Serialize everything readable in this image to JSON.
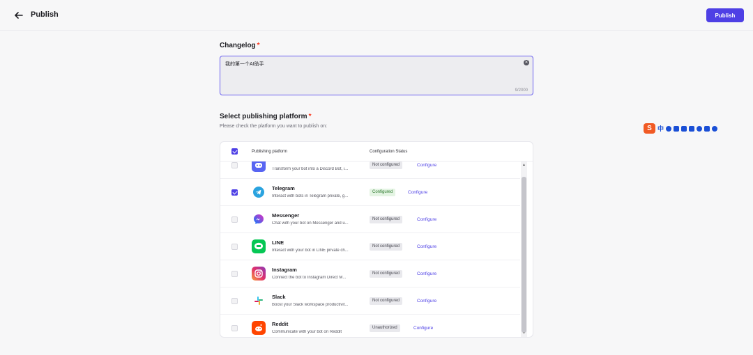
{
  "header": {
    "title": "Publish",
    "publish_label": "Publish",
    "back_icon": "arrow-left-icon"
  },
  "changelog": {
    "label": "Changelog",
    "required_mark": "*",
    "value": "我的第一个AI助手",
    "counter": "9/2000",
    "clear_icon": "clear-circle-icon"
  },
  "platform": {
    "label": "Select publishing platform",
    "required_mark": "*",
    "hint": "Please check the platform you want to publish on:"
  },
  "ime_toolbar": {
    "logo": "S",
    "lang": "中",
    "icons": [
      "punctuation-icon",
      "mic-icon",
      "keyboard-icon",
      "skin-icon",
      "robot-icon",
      "grid-icon",
      "settings-icon"
    ]
  },
  "table": {
    "col_platform": "Publishing platform",
    "col_status": "Configuration Status",
    "header_checked": true,
    "rows": [
      {
        "name": "",
        "desc": "Transform your bot into a Discord Bot, i...",
        "status": "Not configured",
        "configure": "Configure",
        "checked": false,
        "icon": "discord-icon",
        "icon_color": "#5865f2",
        "status_type": "neutral"
      },
      {
        "name": "Telegram",
        "desc": "Interact with bots in Telegram private, g...",
        "status": "Configured",
        "configure": "Configure",
        "checked": true,
        "icon": "telegram-icon",
        "icon_color": "#2aa3df",
        "status_type": "ok"
      },
      {
        "name": "Messenger",
        "desc": "Chat with your bot on Messenger and u...",
        "status": "Not configured",
        "configure": "Configure",
        "checked": false,
        "icon": "messenger-icon",
        "icon_color": "#8a3df0",
        "status_type": "neutral"
      },
      {
        "name": "LINE",
        "desc": "Interact with your bot in LINE private ch...",
        "status": "Not configured",
        "configure": "Configure",
        "checked": false,
        "icon": "line-icon",
        "icon_color": "#06c755",
        "status_type": "neutral"
      },
      {
        "name": "Instagram",
        "desc": "Connect the bot to Instagram Direct M...",
        "status": "Not configured",
        "configure": "Configure",
        "checked": false,
        "icon": "instagram-icon",
        "icon_color": "#e1306c",
        "status_type": "neutral"
      },
      {
        "name": "Slack",
        "desc": "Boost your Slack workspace productivit...",
        "status": "Not configured",
        "configure": "Configure",
        "checked": false,
        "icon": "slack-icon",
        "icon_color": "#ffffff",
        "status_type": "neutral"
      },
      {
        "name": "Reddit",
        "desc": "Communicate with your bot on Reddit",
        "status": "Unauthorized",
        "configure": "Configure",
        "checked": false,
        "icon": "reddit-icon",
        "icon_color": "#ff4500",
        "status_type": "neutral"
      }
    ]
  },
  "colors": {
    "accent": "#4e40e5",
    "required": "#f93920",
    "configured_bg": "#e4f4e3",
    "configured_text": "#2f7a2f"
  }
}
